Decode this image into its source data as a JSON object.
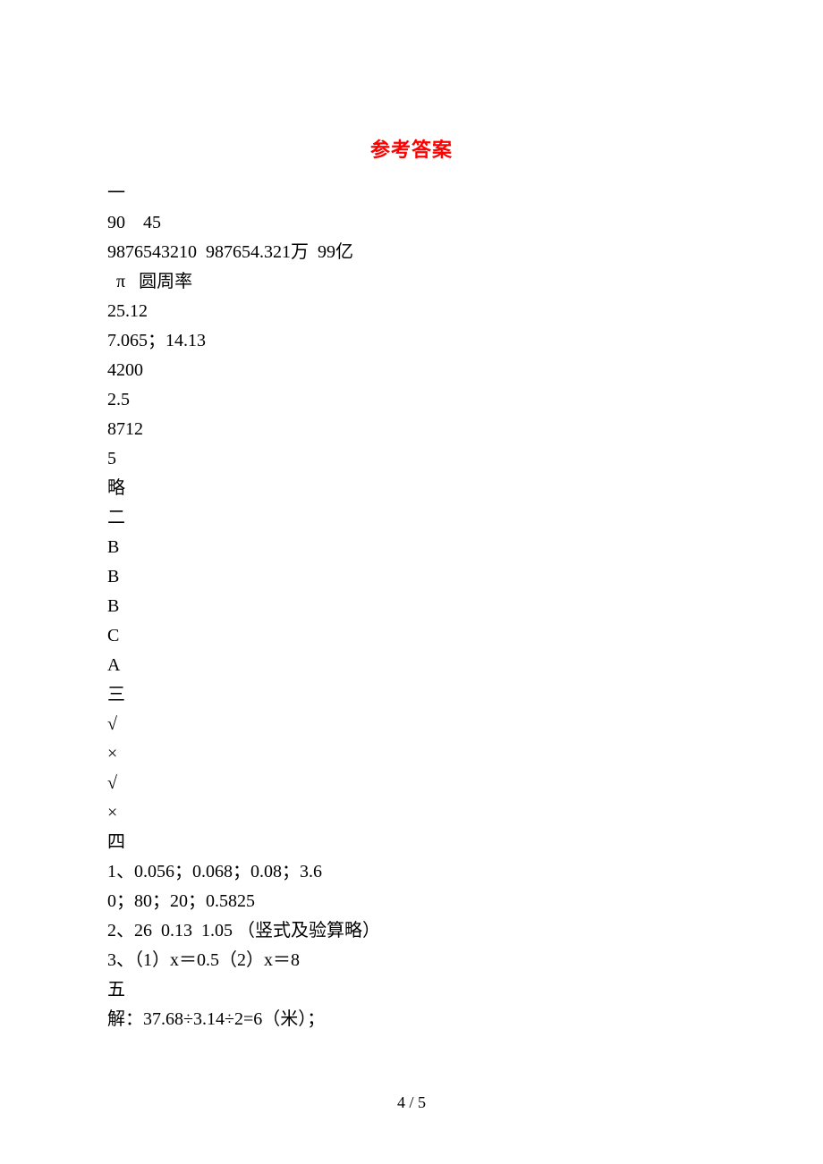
{
  "title": "参考答案",
  "section1": {
    "heading": "一",
    "lines": [
      "90    45",
      "9876543210  987654.321万  99亿",
      "  π   圆周率",
      "25.12",
      "7.065；14.13",
      "4200",
      "2.5",
      "8712",
      "5",
      "略"
    ]
  },
  "section2": {
    "heading": "二",
    "answers": [
      "B",
      "B",
      "B",
      "C",
      "A"
    ]
  },
  "section3": {
    "heading": "三",
    "answers": [
      "√",
      "×",
      "√",
      "×"
    ]
  },
  "section4": {
    "heading": "四",
    "lines": [
      "1、0.056；0.068；0.08；3.6",
      "0；80；20；0.5825",
      "2、26  0.13  1.05 （竖式及验算略）",
      "3、（1）x＝0.5（2）x＝8"
    ]
  },
  "section5": {
    "heading": "五",
    "line": "解：37.68÷3.14÷2=6（米）；"
  },
  "footer": "4 / 5"
}
